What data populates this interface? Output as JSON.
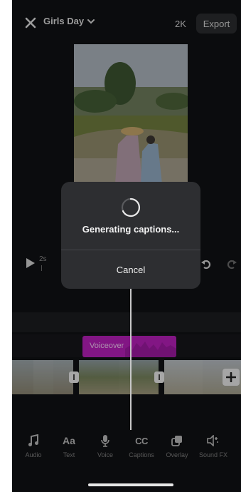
{
  "header": {
    "project_title": "Girls Day",
    "resolution": "2K",
    "export_label": "Export"
  },
  "playback": {
    "time_marker": "2s"
  },
  "timeline": {
    "voiceover_label": "Voiceover"
  },
  "toolbar": {
    "items": [
      {
        "label": "Audio",
        "icon": "music-note-icon"
      },
      {
        "label": "Text",
        "icon": "text-aa-icon"
      },
      {
        "label": "Voice",
        "icon": "microphone-icon"
      },
      {
        "label": "Captions",
        "icon": "cc-icon"
      },
      {
        "label": "Overlay",
        "icon": "overlay-icon"
      },
      {
        "label": "Sound FX",
        "icon": "sound-fx-icon"
      }
    ]
  },
  "modal": {
    "title": "Generating captions...",
    "cancel_label": "Cancel"
  },
  "colors": {
    "background": "#101114",
    "voiceover_clip": "#b41fb7",
    "modal": "#2d2e31"
  }
}
